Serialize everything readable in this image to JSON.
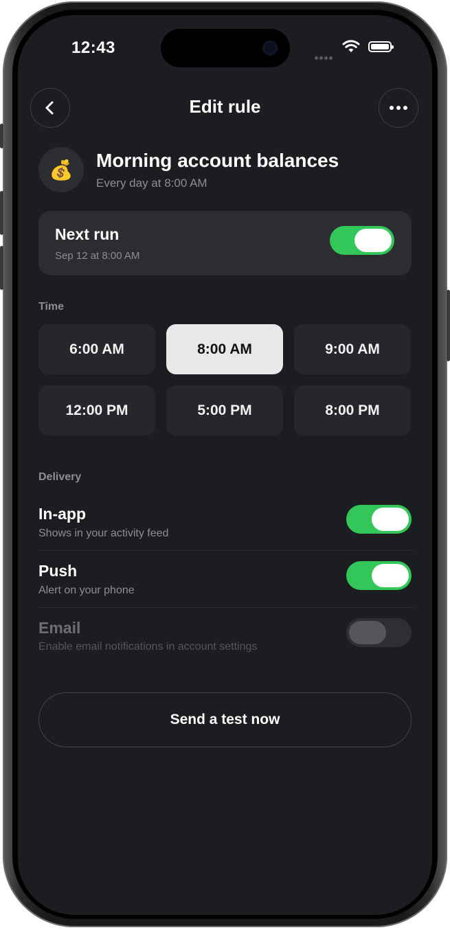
{
  "status_bar": {
    "time": "12:43"
  },
  "nav": {
    "title": "Edit rule"
  },
  "rule": {
    "icon": "money-bag-icon",
    "icon_glyph": "💰",
    "title": "Morning account balances",
    "subtitle": "Every day at 8:00 AM"
  },
  "next_run": {
    "title": "Next run",
    "subtitle": "Sep 12 at 8:00 AM",
    "enabled": true
  },
  "time_section": {
    "label": "Time",
    "options": [
      "6:00 AM",
      "8:00 AM",
      "9:00 AM",
      "12:00 PM",
      "5:00 PM",
      "8:00 PM"
    ],
    "selected": "8:00 AM"
  },
  "delivery": {
    "label": "Delivery",
    "items": [
      {
        "title": "In-app",
        "subtitle": "Shows in your activity feed",
        "enabled": true
      },
      {
        "title": "Push",
        "subtitle": "Alert on your phone",
        "enabled": true
      },
      {
        "title": "Email",
        "subtitle": "Enable email notifications in account settings",
        "enabled": false,
        "disabled": true
      }
    ]
  },
  "action": {
    "label": "Send a test now"
  },
  "colors": {
    "accent_green": "#33c759",
    "background": "#1c1d20",
    "card": "#2c2d31"
  }
}
